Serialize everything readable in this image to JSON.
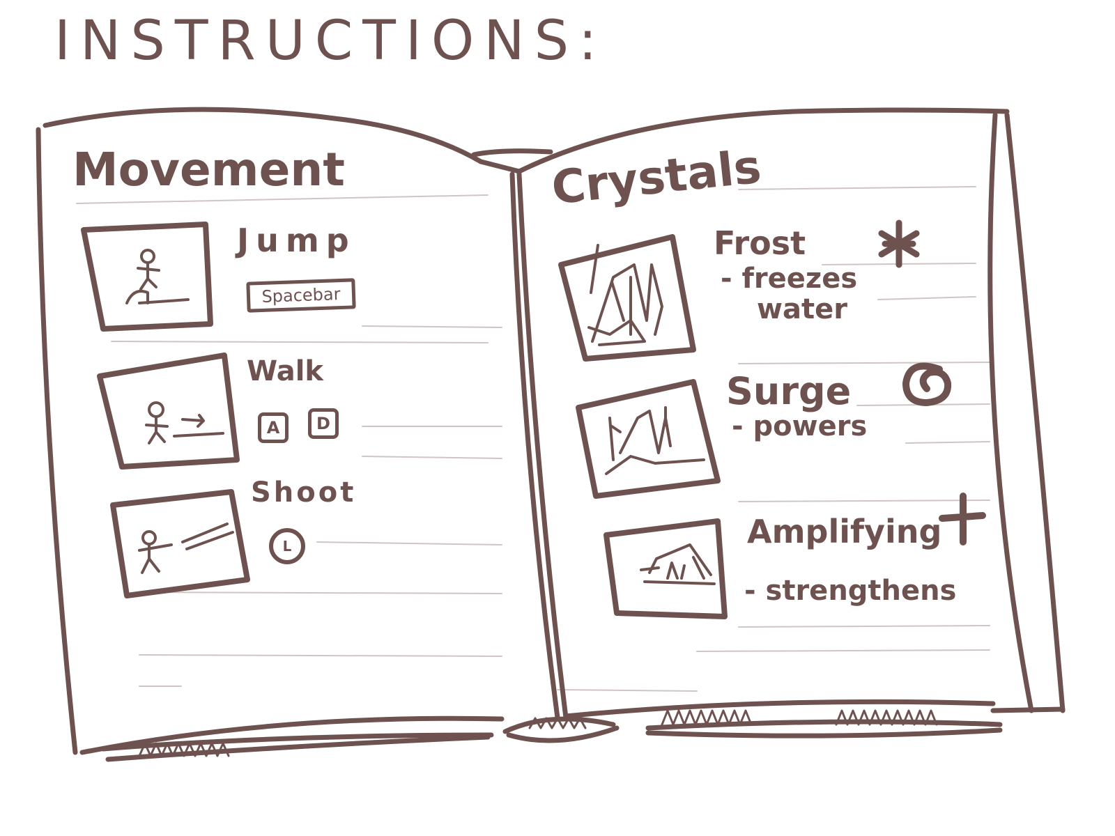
{
  "title": "INSTRUCTIONS:",
  "left_page": {
    "heading": "Movement",
    "items": [
      {
        "label": "Jump",
        "key": "Spacebar",
        "icon": "jump-figure-icon"
      },
      {
        "label": "Walk",
        "keys": [
          "A",
          "D"
        ],
        "icon": "walk-figure-icon"
      },
      {
        "label": "Shoot",
        "mouse": "L",
        "icon": "shoot-figure-icon"
      }
    ]
  },
  "right_page": {
    "heading": "Crystals",
    "items": [
      {
        "label": "Frost",
        "desc_1": "- freezes",
        "desc_2": "water",
        "symbol": "❄",
        "icon": "frost-crystal-icon"
      },
      {
        "label": "Surge",
        "desc_1": "- powers",
        "symbol": "@",
        "icon": "surge-crystal-icon"
      },
      {
        "label": "Amplifying",
        "desc_1": "- strengthens",
        "symbol": "+",
        "icon": "amplifying-crystal-icon"
      }
    ]
  },
  "colors": {
    "ink": "#6e5250",
    "paper": "#ffffff",
    "rule": "#cfc6c4"
  }
}
